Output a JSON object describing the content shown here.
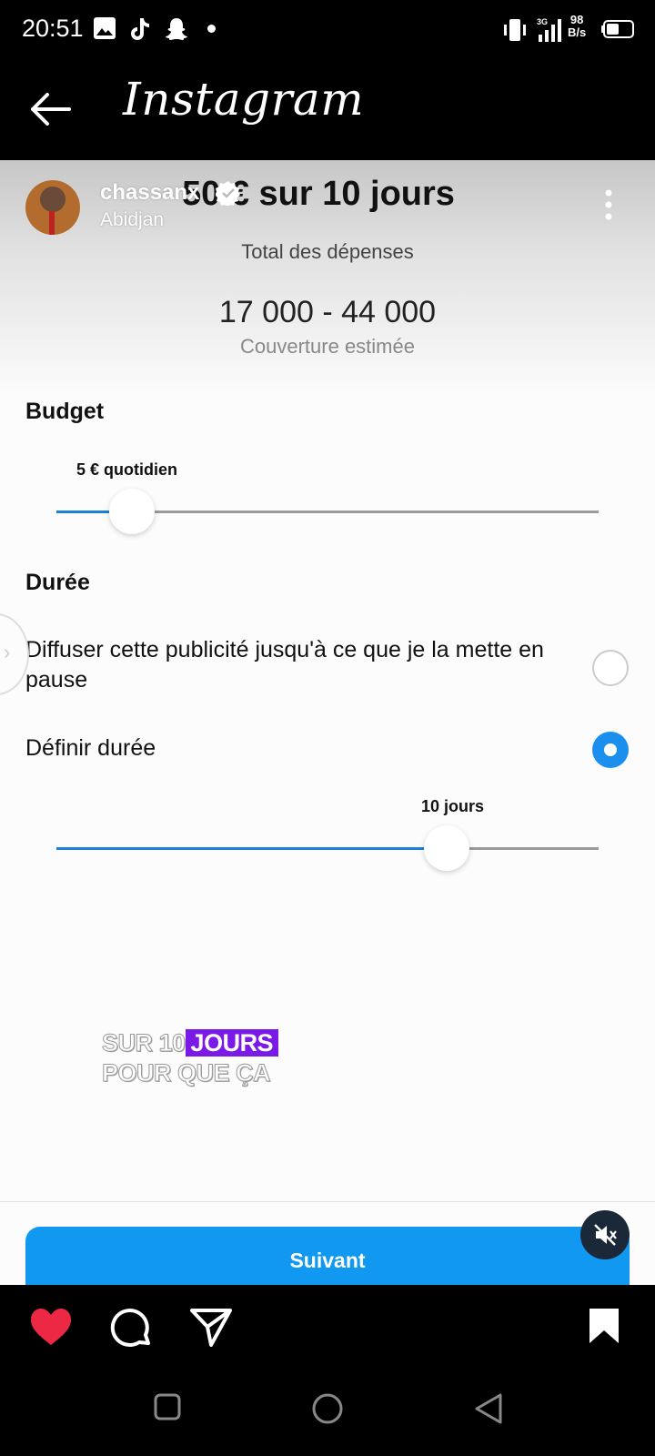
{
  "status_bar": {
    "time": "20:51",
    "network_speed_value": "98",
    "network_speed_unit": "B/s",
    "icons": [
      "gallery-icon",
      "tiktok-icon",
      "snapchat-icon",
      "dot-icon",
      "vibrate-icon",
      "signal-icon",
      "battery-icon"
    ]
  },
  "nav": {
    "title": "Instagram",
    "back_icon": "back-arrow-icon"
  },
  "post": {
    "username": "chassanx",
    "location": "Abidjan",
    "verified": true
  },
  "video": {
    "headline": "50 € sur 10 jours",
    "spend_label": "Total des dépenses",
    "reach_value": "17 000 - 44 000",
    "reach_label": "Couverture estimée",
    "budget": {
      "title": "Budget",
      "slider_label": "5 € quotidien",
      "slider_fraction": 0.14
    },
    "duration": {
      "title": "Durée",
      "option_pause": "Diffuser cette publicité jusqu'à ce que je la mette en pause",
      "option_pause_selected": false,
      "option_set": "Définir durée",
      "option_set_selected": true,
      "slider_label": "10 jours",
      "slider_fraction": 0.72
    },
    "caption_line1_a": "SUR 10",
    "caption_line1_b": "JOURS",
    "caption_line2": "POUR QUE ÇA",
    "cta": "Suivant",
    "accent_color": "#1198f1",
    "caption_highlight_color": "#7b19e6"
  },
  "actions": {
    "liked": true,
    "icons": [
      "heart-icon",
      "comment-icon",
      "share-icon",
      "save-icon"
    ]
  },
  "system_nav": {
    "icons": [
      "recents-icon",
      "home-icon",
      "back-icon"
    ]
  }
}
